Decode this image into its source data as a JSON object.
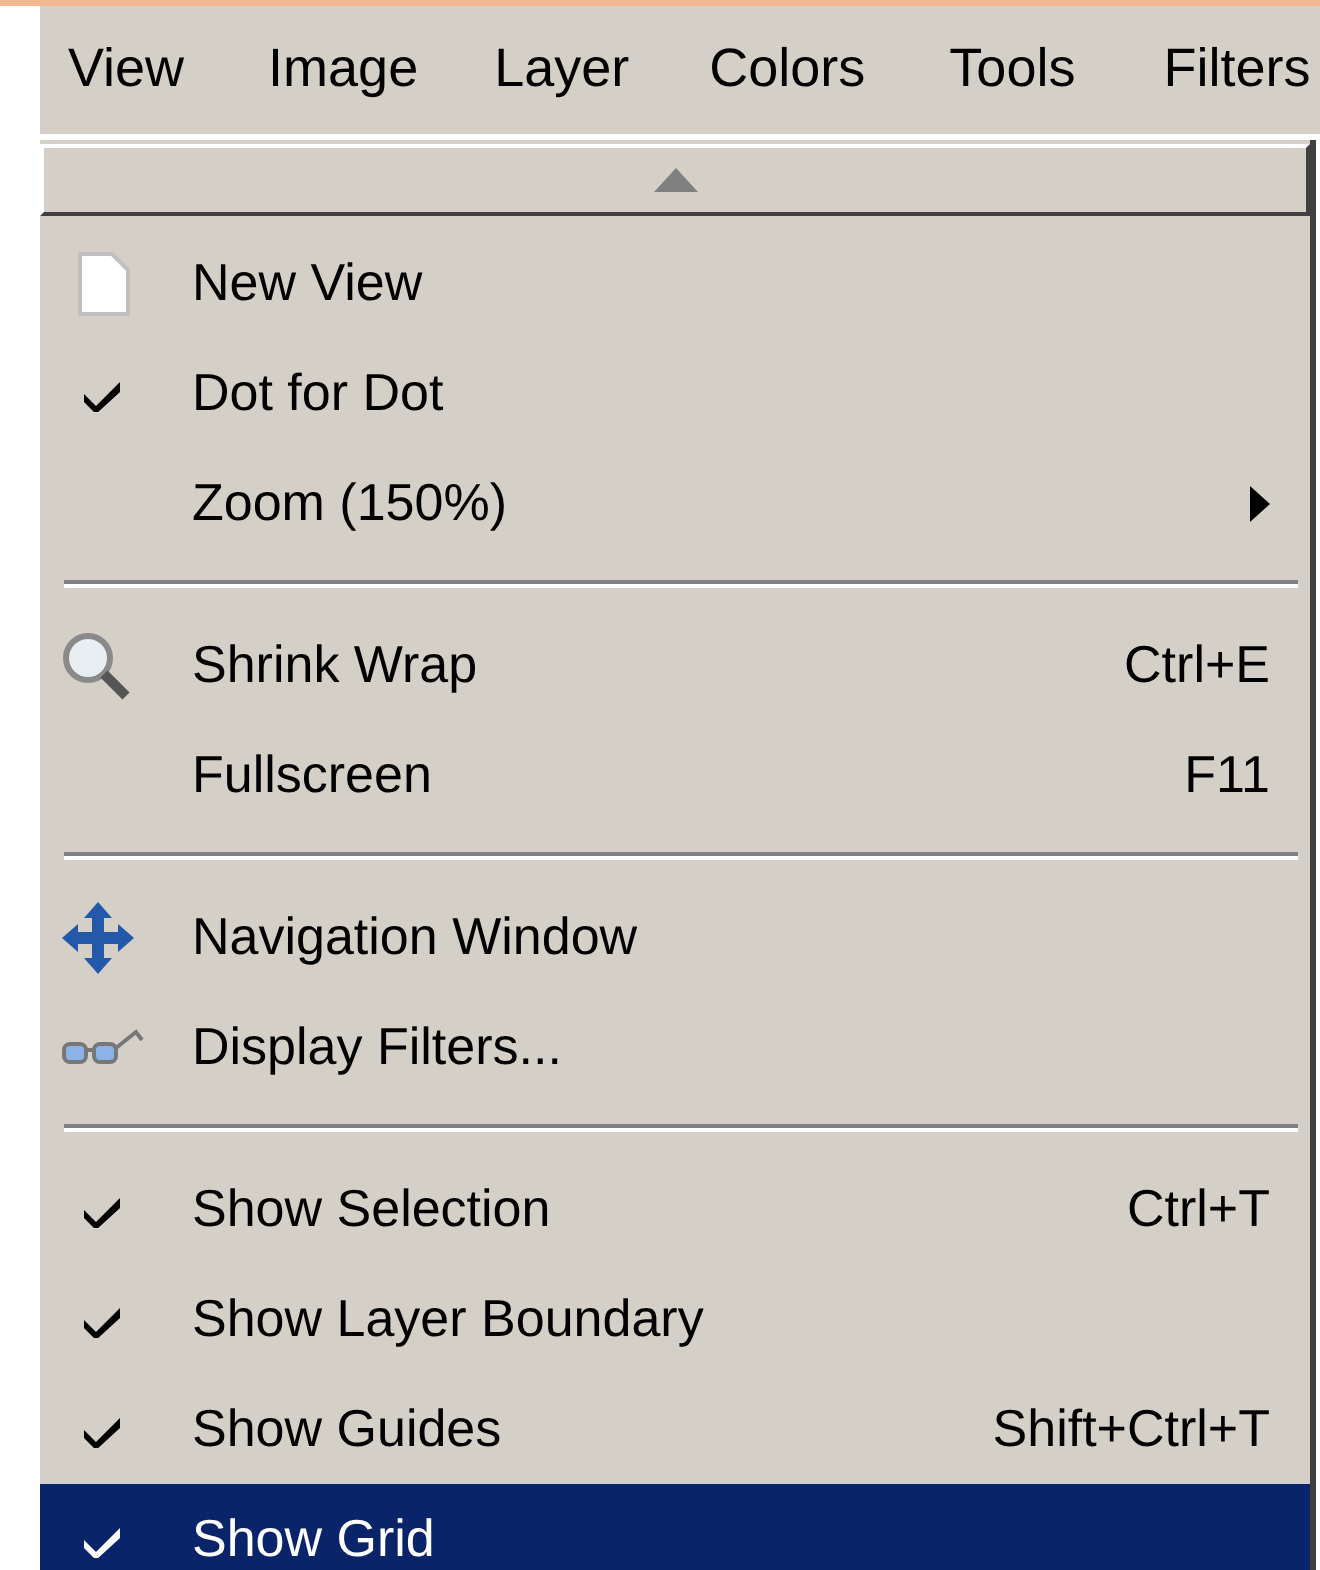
{
  "menubar": [
    {
      "label": "View",
      "selected": true
    },
    {
      "label": "Image",
      "selected": false
    },
    {
      "label": "Layer",
      "selected": false
    },
    {
      "label": "Colors",
      "selected": false
    },
    {
      "label": "Tools",
      "selected": false
    },
    {
      "label": "Filters",
      "selected": false
    }
  ],
  "menu": {
    "items": [
      {
        "kind": "action",
        "label": "New View",
        "selected": false
      },
      {
        "kind": "toggle",
        "label": "Dot for Dot",
        "checked": true,
        "selected": false
      },
      {
        "kind": "submenu",
        "label": "Zoom (150%)",
        "selected": false
      },
      {
        "kind": "separator"
      },
      {
        "kind": "action",
        "label": "Shrink Wrap",
        "shortcut": "Ctrl+E",
        "selected": false
      },
      {
        "kind": "action",
        "label": "Fullscreen",
        "shortcut": "F11",
        "selected": false
      },
      {
        "kind": "separator"
      },
      {
        "kind": "action",
        "label": "Navigation Window",
        "selected": false
      },
      {
        "kind": "action",
        "label": "Display Filters...",
        "selected": false
      },
      {
        "kind": "separator"
      },
      {
        "kind": "toggle",
        "label": "Show Selection",
        "checked": true,
        "shortcut": "Ctrl+T",
        "selected": false
      },
      {
        "kind": "toggle",
        "label": "Show Layer Boundary",
        "checked": true,
        "selected": false
      },
      {
        "kind": "toggle",
        "label": "Show Guides",
        "checked": true,
        "shortcut": "Shift+Ctrl+T",
        "selected": false
      },
      {
        "kind": "toggle",
        "label": "Show Grid",
        "checked": true,
        "selected": true
      }
    ]
  }
}
